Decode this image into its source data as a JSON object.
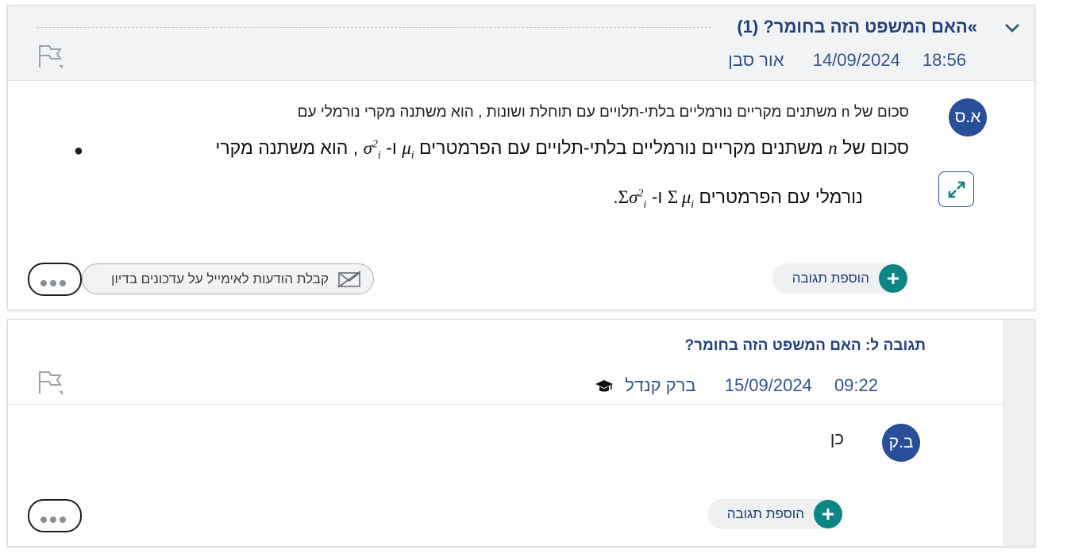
{
  "post1": {
    "title": "»האם המשפט הזה בחומר? (1)",
    "time": "18:56",
    "date": "14/09/2024",
    "author": "אור סבן",
    "avatar_initials": "א.ס",
    "text_line1": "סכום של n משתנים מקריים נורמליים בלתי-תלויים עם תוחלת ושונות , הוא משתנה מקרי נורמלי עם",
    "bullet_part1": "סכום של",
    "bullet_part2": "משתנים מקריים נורמליים בלתי-תלויים עם הפרמטרים",
    "bullet_part3": "ו-",
    "bullet_part4": ", הוא משתנה מקרי",
    "bullet_line2_part1": "נורמלי עם הפרמטרים",
    "bullet_line2_part2": "ו-",
    "math_n": "n",
    "math_mu": "μ",
    "math_sigma": "σ",
    "math_i": "i",
    "math_2": "2",
    "math_sum": "Σ",
    "period": ".",
    "add_reply": "הוספת תגובה",
    "email_notify": "קבלת הודעות לאימייל על עדכונים בדיון"
  },
  "post2": {
    "title": "תגובה ל: האם המשפט הזה בחומר?",
    "time": "09:22",
    "date": "15/09/2024",
    "author": "ברק קנדל",
    "avatar_initials": "ב.ק",
    "text": "כן",
    "add_reply": "הוספת תגובה"
  },
  "colors": {
    "title": "#233f7d",
    "avatar": "#2a4f9a",
    "plus_button": "#0e8585",
    "header_bg": "#f2f3f4"
  },
  "icons": [
    "chevron-down-icon",
    "flag-icon",
    "expand-icon",
    "plus-icon",
    "email-off-icon",
    "more-icon",
    "graduation-cap-icon"
  ]
}
